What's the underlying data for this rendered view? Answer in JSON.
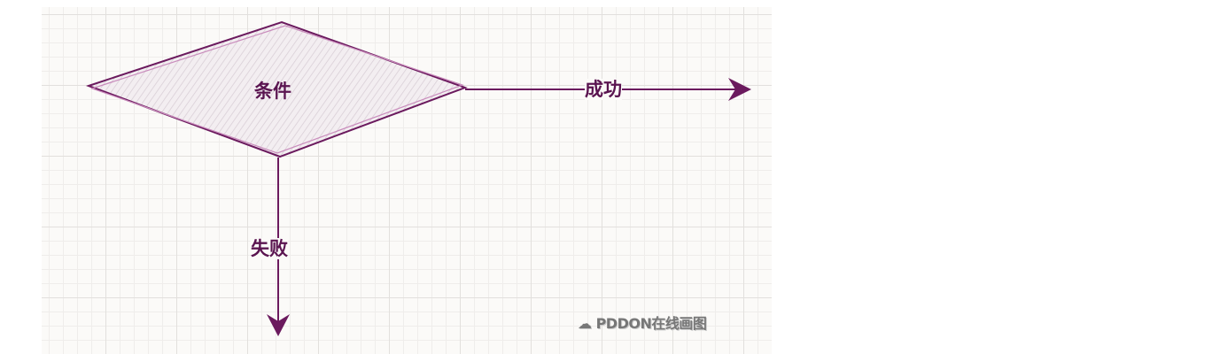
{
  "diagram": {
    "condition_label": "条件",
    "success_label": "成功",
    "failure_label": "失败",
    "stroke_color": "#6b1a5e",
    "fill_color": "#e9dfe6"
  },
  "watermark": "PDDON在线画图"
}
